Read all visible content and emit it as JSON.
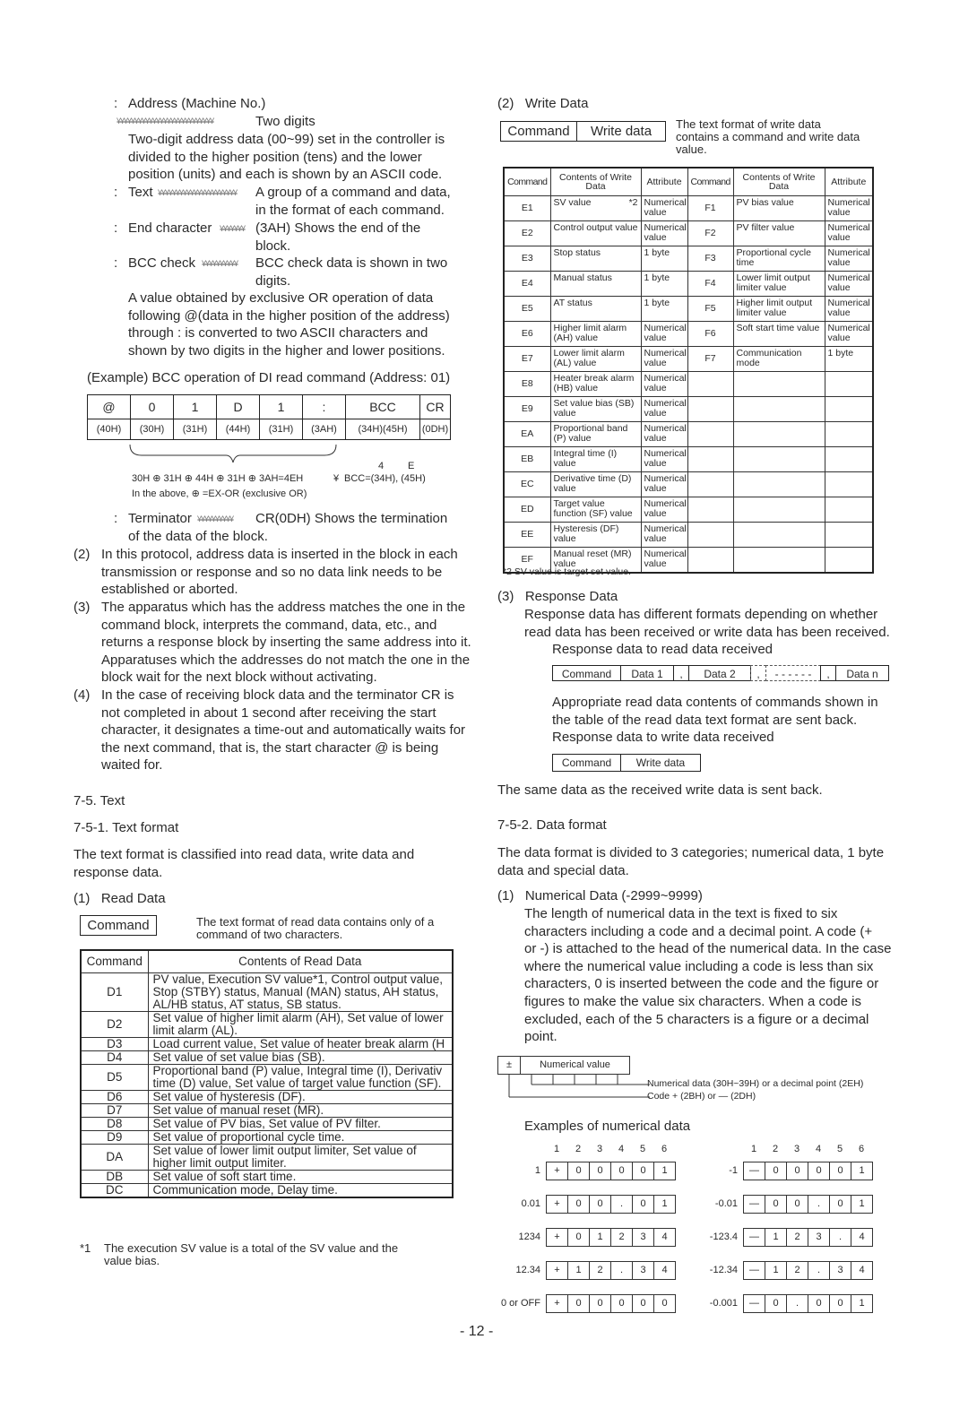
{
  "left": {
    "address": {
      "label": "Address (Machine No.)",
      "value": "Two digits",
      "desc": [
        "Two-digit address data (00~99) set in the controller is",
        "divided to the higher position (tens) and the lower",
        "position (units) and each is shown by an ASCII code."
      ]
    },
    "text_item": {
      "label": "Text",
      "desc": [
        "A group of a command and data,",
        "in the format of each command."
      ]
    },
    "end_char": {
      "label": "End character",
      "desc": [
        "(3AH)  Shows the end of the",
        "block."
      ]
    },
    "bcc_check": {
      "label": "BCC check",
      "desc": [
        "BCC check data is shown in two",
        "digits."
      ]
    },
    "bcc_desc": [
      "A value obtained by exclusive OR operation of data",
      "following @(data in the higher position of the address)",
      "through : is converted to two ASCII characters and",
      "shown by two digits in the higher and lower positions."
    ],
    "example_title": "(Example)  BCC operation of DI read command (Address: 01)",
    "example_table": {
      "chars": [
        "@",
        "0",
        "1",
        "D",
        "1",
        ":",
        "BCC",
        "CR"
      ],
      "hex": [
        "(40H)",
        "(30H)",
        "(31H)",
        "(44H)",
        "(31H)",
        "(3AH)",
        "(34H)(45H)",
        "(0DH)"
      ]
    },
    "xor_expr": "30H ⊕  31H ⊕ 44H ⊕ 31H ⊕ 3AH=4EH",
    "bcc_result": "BCC=(34H), (45H)",
    "bcc_digits": [
      "4",
      "E"
    ],
    "xor_note": "In the above,  ⊕ =EX-OR (exclusive OR)",
    "terminator": {
      "label": "Terminator",
      "desc": [
        "CR(0DH)  Shows the termination",
        "of the data of the block."
      ]
    },
    "items": [
      {
        "num": "(2)",
        "lines": [
          "In this protocol, address data is inserted in the block in each",
          "transmission or response and so no data link needs to be",
          "established or aborted."
        ]
      },
      {
        "num": "(3)",
        "lines": [
          "The apparatus which has the address matches the one in the",
          "command block, interprets the command, data, etc., and",
          "returns a response block by inserting the same address into it.",
          "Apparatuses which the addresses do not match the one in the",
          "block wait for the next block without activating."
        ]
      },
      {
        "num": "(4)",
        "lines": [
          "In the case of receiving block data and the terminator CR is",
          "not completed in about 1 second after receiving the start",
          "character, it designates a time-out and automatically waits for",
          "the next command, that is, the start character @ is being",
          "waited for."
        ]
      }
    ],
    "section_7_5": "7-5. Text",
    "section_7_5_1": "7-5-1. Text format",
    "text_format_desc": [
      "The text format is classified into read data, write data and",
      "response data."
    ],
    "read_data": {
      "title": "(1)   Read Data",
      "box_label": "Command",
      "desc": [
        "The text format of read data contains only of a",
        "command of two characters."
      ],
      "headers": [
        "Command",
        "Contents of Read Data"
      ],
      "rows": [
        {
          "cmd": "D1",
          "lines": [
            "PV value, Execution SV value*1, Control output value,",
            "Stop (STBY) status, Manual (MAN) status, AH status,",
            "AL/HB status, AT status, SB status."
          ]
        },
        {
          "cmd": "D2",
          "lines": [
            "Set value of higher limit alarm (AH), Set value of lower",
            "limit alarm (AL)."
          ]
        },
        {
          "cmd": "D3",
          "lines": [
            "Load current value, Set value of heater break alarm (H"
          ]
        },
        {
          "cmd": "D4",
          "lines": [
            "Set value of set value bias (SB)."
          ]
        },
        {
          "cmd": "D5",
          "lines": [
            "Proportional band (P) value, Integral time (I), Derivativ",
            "time (D) value, Set value of target value function (SF)."
          ]
        },
        {
          "cmd": "D6",
          "lines": [
            "Set value of hysteresis (DF)."
          ]
        },
        {
          "cmd": "D7",
          "lines": [
            "Set value of manual reset (MR)."
          ]
        },
        {
          "cmd": "D8",
          "lines": [
            "Set value of PV bias, Set value of PV filter."
          ]
        },
        {
          "cmd": "D9",
          "lines": [
            "Set value of proportional cycle time."
          ]
        },
        {
          "cmd": "DA",
          "lines": [
            "Set value of lower limit output limiter, Set value of",
            "higher limit output limiter."
          ]
        },
        {
          "cmd": "DB",
          "lines": [
            "Set value of soft start time."
          ]
        },
        {
          "cmd": "DC",
          "lines": [
            "Communication mode, Delay time."
          ]
        }
      ],
      "footnote_mark": "*1",
      "footnote": [
        "The execution SV value is a total of the SV value and the",
        "value bias."
      ]
    }
  },
  "right": {
    "write_data": {
      "title": "(2)   Write Data",
      "box_cells": [
        "Command",
        "Write data"
      ],
      "desc": [
        "The text format of write data",
        "contains a command and write data",
        "value."
      ],
      "headers": [
        "Command",
        "Contents of Write Data",
        "Attribute",
        "Command",
        "Contents of Write Data",
        "Attribute"
      ],
      "rows": [
        {
          "c1": "E1",
          "d1": "SV value",
          "n1": "*2",
          "a1": "Numerical value",
          "c2": "F1",
          "d2": "PV bias value",
          "a2": "Numerical value"
        },
        {
          "c1": "E2",
          "d1": "Control output value",
          "a1": "Numerical value",
          "c2": "F2",
          "d2": "PV filter value",
          "a2": "Numerical value"
        },
        {
          "c1": "E3",
          "d1": "Stop status",
          "a1": "1 byte",
          "c2": "F3",
          "d2": "Proportional cycle time",
          "a2": "Numerical value"
        },
        {
          "c1": "E4",
          "d1": "Manual status",
          "a1": "1 byte",
          "c2": "F4",
          "d2": "Lower limit output limiter value",
          "a2": "Numerical value"
        },
        {
          "c1": "E5",
          "d1": "AT status",
          "a1": "1 byte",
          "c2": "F5",
          "d2": "Higher limit output limiter value",
          "a2": "Numerical value"
        },
        {
          "c1": "E6",
          "d1": "Higher limit alarm (AH) value",
          "a1": "Numerical value",
          "c2": "F6",
          "d2": "Soft start time value",
          "a2": "Numerical value"
        },
        {
          "c1": "E7",
          "d1": "Lower limit alarm (AL) value",
          "a1": "Numerical value",
          "c2": "F7",
          "d2": "Communication mode",
          "a2": "1 byte"
        },
        {
          "c1": "E8",
          "d1": "Heater break alarm (HB) value",
          "a1": "Numerical value"
        },
        {
          "c1": "E9",
          "d1": "Set value bias (SB) value",
          "a1": "Numerical value"
        },
        {
          "c1": "EA",
          "d1": "Proportional band (P) value",
          "a1": "Numerical value"
        },
        {
          "c1": "EB",
          "d1": "Integral time (I) value",
          "a1": "Numerical value"
        },
        {
          "c1": "EC",
          "d1": "Derivative time (D) value",
          "a1": "Numerical value"
        },
        {
          "c1": "ED",
          "d1": "Target value function (SF) value",
          "a1": "Numerical value"
        },
        {
          "c1": "EE",
          "d1": "Hysteresis (DF) value",
          "a1": "Numerical value"
        },
        {
          "c1": "EF",
          "d1": "Manual reset (MR) value",
          "a1": "Numerical value"
        }
      ],
      "footnote": "*2   SV value is target set value."
    },
    "response_data": {
      "title": "(3)   Response Data",
      "desc": [
        "Response data has different formats depending on whether",
        "read data has been received or write data has been received."
      ],
      "read_title": "Response data to read data received",
      "read_cells": [
        "Command",
        "Data 1",
        ",",
        "Data 2",
        ",",
        "- - - - - -",
        ",",
        "Data n"
      ],
      "read_desc": [
        "Appropriate read data contents of commands shown in",
        "the table of the read data text format are sent back."
      ],
      "write_title": "Response data to write data received",
      "write_cells": [
        "Command",
        "Write data"
      ],
      "write_desc": "The same data as the received write data is sent back."
    },
    "section_7_5_2": "7-5-2. Data format",
    "data_format_desc": [
      "The data format is divided to 3 categories; numerical data, 1 byte",
      "data and special data."
    ],
    "numerical": {
      "title": "(1)   Numerical Data (-2999~9999)",
      "desc": [
        "The length of numerical data in the text is fixed to six",
        "characters including a code and a decimal point.  A code (+",
        "or -) is attached to the head of the numerical data.  In the case",
        "where the numerical value including a code is less than six",
        "characters, 0 is inserted between the code and the figure or",
        "figures to make the value six characters.  When a code is",
        "excluded, each of the 5 characters is a figure or a decimal",
        "point."
      ],
      "diagram": {
        "sign": "±",
        "value_label": "Numerical value",
        "note_data": "Numerical data (30H~39H) or a decimal point (2EH)",
        "note_code": "Code + (2BH) or — (2DH)"
      },
      "examples_title": "Examples of numerical data",
      "positions": [
        "1",
        "2",
        "3",
        "4",
        "5",
        "6"
      ],
      "examples_left": [
        {
          "label": "1",
          "cells": [
            "+",
            "0",
            "0",
            "0",
            "0",
            "1"
          ]
        },
        {
          "label": "0.01",
          "cells": [
            "+",
            "0",
            "0",
            ".",
            "0",
            "1"
          ]
        },
        {
          "label": "1234",
          "cells": [
            "+",
            "0",
            "1",
            "2",
            "3",
            "4"
          ]
        },
        {
          "label": "12.34",
          "cells": [
            "+",
            "1",
            "2",
            ".",
            "3",
            "4"
          ]
        },
        {
          "label": "0 or OFF",
          "cells": [
            "+",
            "0",
            "0",
            "0",
            "0",
            "0"
          ]
        }
      ],
      "examples_right": [
        {
          "label": "-1",
          "cells": [
            "—",
            "0",
            "0",
            "0",
            "0",
            "1"
          ]
        },
        {
          "label": "-0.01",
          "cells": [
            "—",
            "0",
            "0",
            ".",
            "0",
            "1"
          ]
        },
        {
          "label": "-123.4",
          "cells": [
            "—",
            "1",
            "2",
            "3",
            ".",
            "4"
          ]
        },
        {
          "label": "-12.34",
          "cells": [
            "—",
            "1",
            "2",
            ".",
            "3",
            "4"
          ]
        },
        {
          "label": "-0.001",
          "cells": [
            "—",
            "0",
            ".",
            "0",
            "0",
            "1"
          ]
        }
      ]
    }
  },
  "page_number": "- 12 -"
}
